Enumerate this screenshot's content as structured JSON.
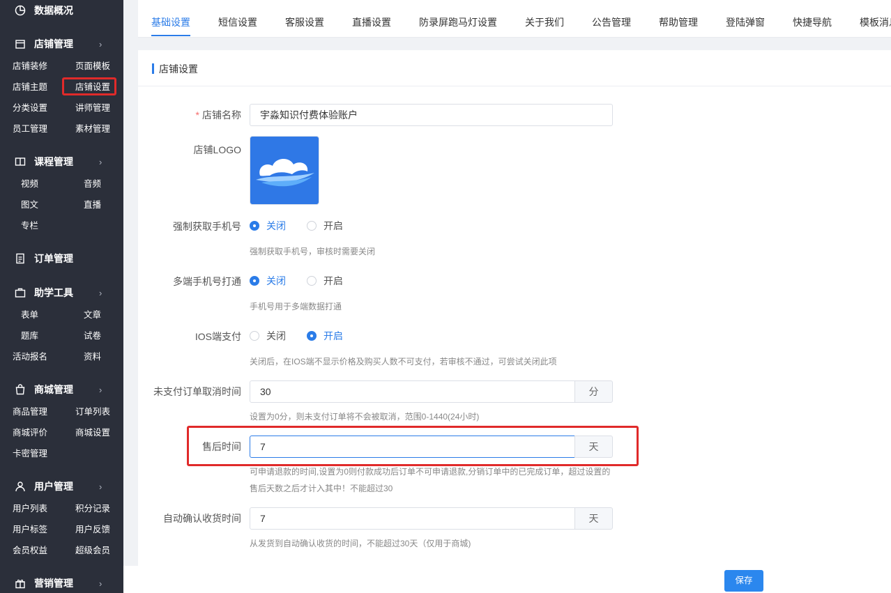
{
  "sidebar": {
    "top_item": {
      "label": "数据概况",
      "icon": "pie-chart-icon"
    },
    "groups": [
      {
        "label": "店铺管理",
        "icon": "store-icon",
        "items": [
          "店铺装修",
          "页面模板",
          "店铺主题",
          "店铺设置",
          "分类设置",
          "讲师管理",
          "员工管理",
          "素材管理"
        ]
      },
      {
        "label": "课程管理",
        "icon": "book-icon",
        "items": [
          "视频",
          "音频",
          "图文",
          "直播",
          "专栏"
        ]
      },
      {
        "label": "订单管理",
        "icon": "document-icon",
        "items": []
      },
      {
        "label": "助学工具",
        "icon": "briefcase-icon",
        "items": [
          "表单",
          "文章",
          "题库",
          "试卷",
          "活动报名",
          "资料"
        ]
      },
      {
        "label": "商城管理",
        "icon": "shopping-bag-icon",
        "items": [
          "商品管理",
          "订单列表",
          "商城评价",
          "商城设置",
          "卡密管理"
        ]
      },
      {
        "label": "用户管理",
        "icon": "user-icon",
        "items": [
          "用户列表",
          "积分记录",
          "用户标签",
          "用户反馈",
          "会员权益",
          "超级会员"
        ]
      },
      {
        "label": "营销管理",
        "icon": "gift-icon",
        "items": []
      }
    ],
    "active_item": "店铺设置"
  },
  "tabs": [
    "基础设置",
    "短信设置",
    "客服设置",
    "直播设置",
    "防录屏跑马灯设置",
    "关于我们",
    "公告管理",
    "帮助管理",
    "登陆弹窗",
    "快捷导航",
    "模板消息"
  ],
  "active_tab": "基础设置",
  "card": {
    "title": "店铺设置",
    "fields": {
      "store_name": {
        "label": "店铺名称",
        "required_mark": "*",
        "value": "宇淼知识付费体验账户"
      },
      "store_logo": {
        "label": "店铺LOGO"
      },
      "force_phone": {
        "label": "强制获取手机号",
        "options": [
          "关闭",
          "开启"
        ],
        "selected": "关闭",
        "hint": "强制获取手机号，审核时需要关闭"
      },
      "multi_phone": {
        "label": "多端手机号打通",
        "options": [
          "关闭",
          "开启"
        ],
        "selected": "关闭",
        "hint": "手机号用于多端数据打通"
      },
      "ios_pay": {
        "label": "IOS端支付",
        "options": [
          "关闭",
          "开启"
        ],
        "selected": "开启",
        "hint": "关闭后，在IOS端不显示价格及购买人数不可支付，若审核不通过，可尝试关闭此项"
      },
      "unpaid_cancel": {
        "label": "未支付订单取消时间",
        "value": "30",
        "unit": "分",
        "hint": "设置为0分，则未支付订单将不会被取消，范围0-1440(24小时)"
      },
      "after_sale": {
        "label": "售后时间",
        "value": "7",
        "unit": "天",
        "hint_line1": "可申请退款的时间,设置为0则付款成功后订单不可申请退款,分销订单中的已完成订单，超过设置的",
        "hint_line2": "售后天数之后才计入其中！不能超过30"
      },
      "auto_confirm": {
        "label": "自动确认收货时间",
        "value": "7",
        "unit": "天",
        "hint": "从发货到自动确认收货的时间，不能超过30天（仅用于商城)"
      }
    },
    "save_label": "保存"
  },
  "colors": {
    "sidebar_bg": "#2b2f3a",
    "accent": "#2b7ce8",
    "highlight": "#e02a2a"
  }
}
